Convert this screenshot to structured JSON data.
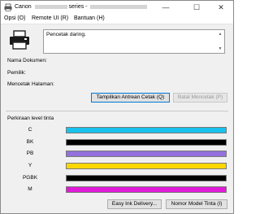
{
  "window": {
    "title_prefix": "Canon",
    "title_suffix": "series -",
    "minimize": "—",
    "maximize": "☐",
    "close": "✕"
  },
  "menu": [
    {
      "label": "Opsi (O)"
    },
    {
      "label": "Remote UI (R)"
    },
    {
      "label": "Bantuan (H)"
    }
  ],
  "status": {
    "text": "Pencetak daring."
  },
  "job_info": {
    "doc_name_label": "Nama Dokumen:",
    "owner_label": "Pemilik:",
    "printing_page_label": "Mencetak Halaman:"
  },
  "buttons": {
    "show_queue": "Tampilkan Antrean Cetak (Q)",
    "cancel_print": "Batal Mencetak (P)",
    "easy_ink": "Easy Ink Delivery...",
    "ink_model": "Nomor Model Tinta (I)"
  },
  "ink": {
    "heading": "Perkiraan level tinta",
    "levels": [
      {
        "label": "C",
        "color": "#19c2ec",
        "level": 1.0
      },
      {
        "label": "BK",
        "color": "#000000",
        "level": 1.0
      },
      {
        "label": "PB",
        "color": "#9370db",
        "level": 1.0
      },
      {
        "label": "Y",
        "color": "#ffd700",
        "level": 1.0
      },
      {
        "label": "PGBK",
        "color": "#000000",
        "level": 1.0
      },
      {
        "label": "M",
        "color": "#e01ad6",
        "level": 1.0
      }
    ]
  }
}
